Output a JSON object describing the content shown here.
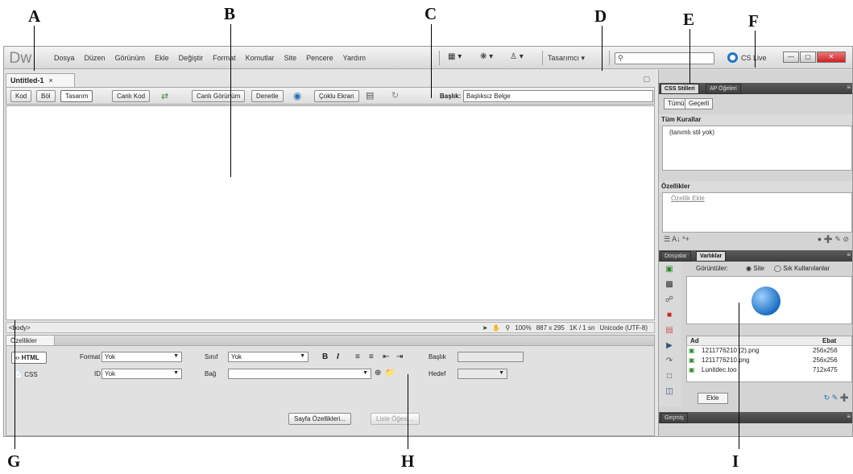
{
  "callouts": [
    "A",
    "B",
    "C",
    "D",
    "E",
    "F",
    "G",
    "H",
    "I"
  ],
  "app": {
    "logo": "Dw",
    "menu": [
      "Dosya",
      "Düzen",
      "Görünüm",
      "Ekle",
      "Değiştir",
      "Format",
      "Komutlar",
      "Site",
      "Pencere",
      "Yardım"
    ],
    "workspace": "Tasarımcı ▾",
    "search_placeholder": "",
    "cs_live": "CS Live"
  },
  "document": {
    "tab_title": "Untitled-1",
    "view_buttons": [
      "Kod",
      "Böl",
      "Tasarım"
    ],
    "live_code": "Canlı Kod",
    "live_view": "Canlı Görünüm",
    "inspect": "Denetle",
    "multiscreen": "Çoklu Ekran",
    "title_label": "Başlık:",
    "title_value": "Başlıksız Belge",
    "tag_selector": "<body>",
    "zoom": "100%",
    "window_size": "887 x 295",
    "file_size": "1K / 1 sn",
    "encoding": "Unicode (UTF-8)"
  },
  "properties": {
    "tab": "Özellikler",
    "html_btn": "HTML",
    "css_btn": "CSS",
    "format_label": "Format",
    "format_value": "Yok",
    "id_label": "ID",
    "id_value": "Yok",
    "class_label": "Sınıf",
    "class_value": "Yok",
    "link_label": "Bağ",
    "title_label": "Başlık",
    "target_label": "Hedef",
    "page_props": "Sayfa Özellikleri...",
    "list_item": "Liste Öğesi..."
  },
  "css_panel": {
    "tabs": [
      "CSS Stilleri",
      "AP Öğeleri"
    ],
    "all_btn": "Tümü",
    "current_btn": "Geçerli",
    "rules_title": "Tüm Kurallar",
    "no_style": "(tanımlı stil yok)",
    "props_title": "Özellikler",
    "add_prop": "Özellik Ekle"
  },
  "assets_panel": {
    "tabs": [
      "Dosyalar",
      "Varlıklar"
    ],
    "images_label": "Görüntüler:",
    "site_opt": "Site",
    "fav_opt": "Sık Kullanılanlar",
    "col_name": "Ad",
    "col_size": "Ebat",
    "files": [
      {
        "name": "1211776210 (2).png",
        "size": "256x256"
      },
      {
        "name": "1211776210.png",
        "size": "256x256"
      },
      {
        "name": "Lunitdec.too",
        "size": "712x475"
      }
    ],
    "insert_btn": "Ekle"
  },
  "history_tab": "Geçmiş"
}
